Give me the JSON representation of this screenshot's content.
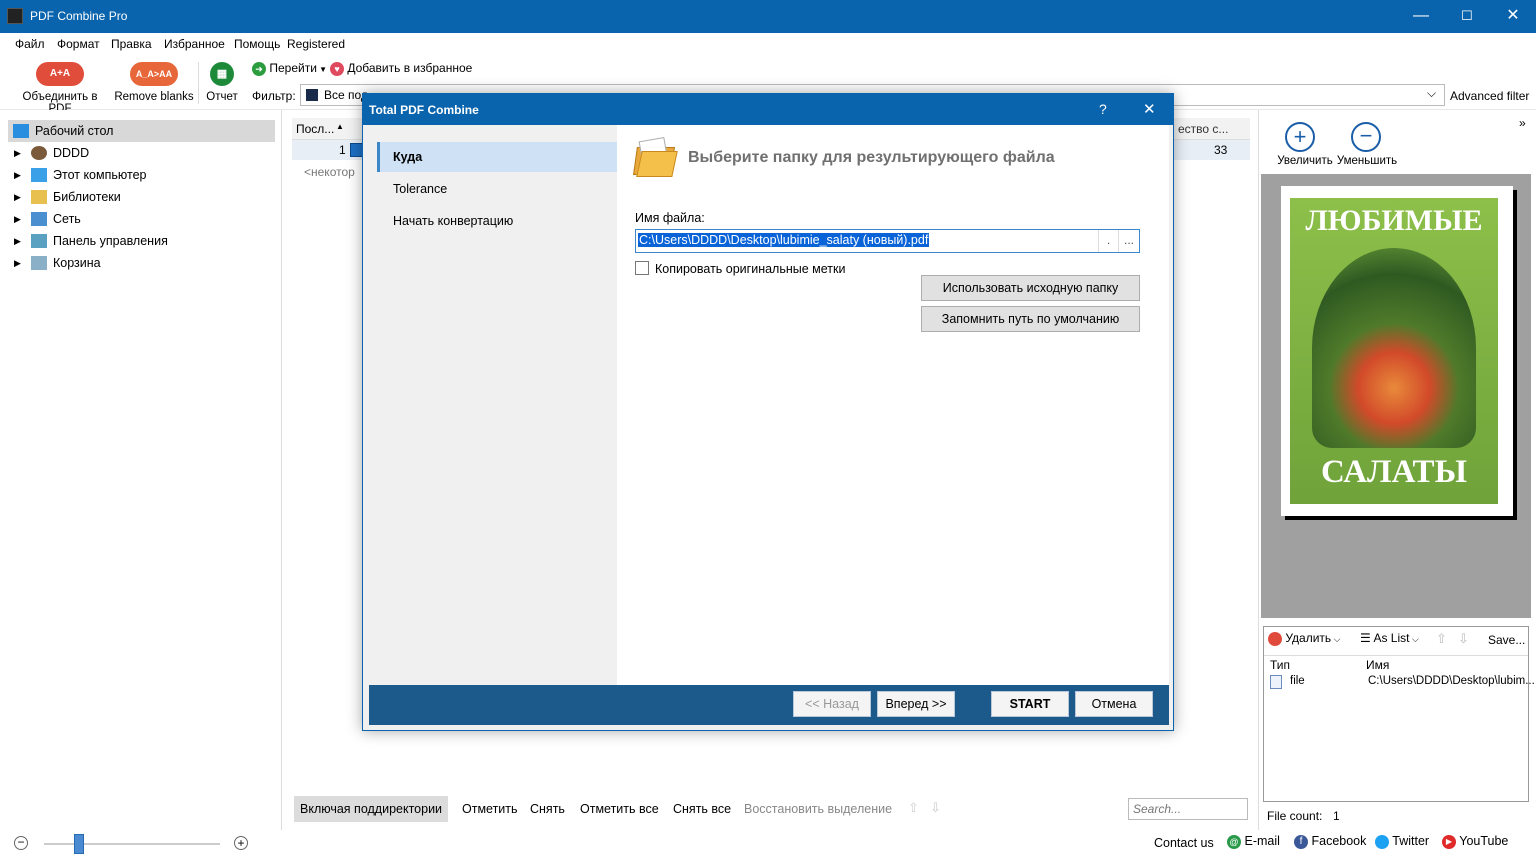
{
  "window": {
    "title": "PDF Combine Pro",
    "minimize": "—",
    "maximize": "☐",
    "close": "✕"
  },
  "menu": [
    "Файл",
    "Формат",
    "Правка",
    "Избранное",
    "Помощь",
    "Registered"
  ],
  "toolbar": {
    "combine_label": "Объединить в PDF",
    "combine_icon_text": "A+A",
    "remove_blanks_label": "Remove blanks",
    "remove_blanks_icon_text": "A_A>AA",
    "report_label": "Отчет",
    "goto_label": "Перейти",
    "favorite_label": "Добавить в избранное",
    "filter_label": "Фильтр:",
    "filter_value": "Все под",
    "advanced_filter": "Advanced filter"
  },
  "tree": [
    {
      "label": "Рабочий стол",
      "icon": "desktop-icon",
      "expandable": false,
      "selected": true
    },
    {
      "label": "DDDD",
      "icon": "user-icon",
      "expandable": true
    },
    {
      "label": "Этот компьютер",
      "icon": "computer-icon",
      "expandable": true
    },
    {
      "label": "Библиотеки",
      "icon": "library-icon",
      "expandable": true
    },
    {
      "label": "Сеть",
      "icon": "network-icon",
      "expandable": true
    },
    {
      "label": "Панель управления",
      "icon": "control-panel-icon",
      "expandable": true
    },
    {
      "label": "Корзина",
      "icon": "recycle-bin-icon",
      "expandable": true
    }
  ],
  "list": {
    "col_seq": "Посл...",
    "col_count": "ество с...",
    "row_num": "1",
    "row_count": "33",
    "more_text": "<некотор"
  },
  "preview": {
    "zoom_in": "Увеличить",
    "zoom_out": "Уменьшить",
    "cover_top": "ЛЮБИМЫЕ",
    "cover_bottom": "САЛАТЫ",
    "delete_label": "Удалить",
    "as_list_label": "As List",
    "save_label": "Save...",
    "col_type": "Тип",
    "col_name": "Имя",
    "file_type": "file",
    "file_path": "C:\\Users\\DDDD\\Desktop\\lubim...",
    "file_count_label": "File count:",
    "file_count": "1"
  },
  "dialog": {
    "title": "Total PDF Combine",
    "help": "?",
    "close": "✕",
    "nav": [
      "Куда",
      "Tolerance",
      "Начать конвертацию"
    ],
    "heading": "Выберите папку для результирующего файла",
    "filename_label": "Имя файла:",
    "filename_value": "C:\\Users\\DDDD\\Desktop\\lubimie_salaty (новый).pdf",
    "dot_btn": ".",
    "browse_btn": "...",
    "copy_marks_label": "Копировать оригинальные метки",
    "use_source_btn": "Использовать исходную папку",
    "remember_path_btn": "Запомнить путь по умолчанию",
    "back_btn": "<< Назад",
    "next_btn": "Вперед >>",
    "start_btn": "START",
    "cancel_btn": "Отмена"
  },
  "bottom": {
    "include_subdirs": "Включая поддиректории",
    "mark": "Отметить",
    "unmark": "Снять",
    "mark_all": "Отметить все",
    "unmark_all": "Снять все",
    "restore_selection": "Восстановить выделение",
    "search_placeholder": "Search..."
  },
  "status": {
    "contact": "Contact us",
    "email": "E-mail",
    "facebook": "Facebook",
    "twitter": "Twitter",
    "youtube": "YouTube",
    "zoom_level": 0.2
  },
  "colors": {
    "accent": "#0a64ad",
    "footer": "#1d5a8c",
    "selection": "#cfe2f5"
  }
}
